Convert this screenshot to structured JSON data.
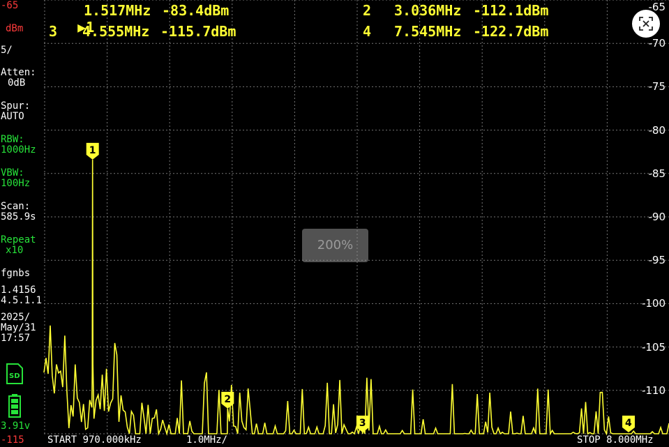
{
  "top_left_ref": "-65",
  "unit": "dBm",
  "scale": "5/",
  "attenuation": {
    "label": "Atten:",
    "value": "0dB"
  },
  "spur": {
    "label": "Spur:",
    "value": "AUTO"
  },
  "rbw": {
    "label": "RBW:",
    "value": "1000Hz"
  },
  "vbw": {
    "label": "VBW:",
    "value": "100Hz"
  },
  "scan": {
    "label": "Scan:",
    "value": "585.9s"
  },
  "repeat": {
    "label": "Repeat",
    "value": "x10"
  },
  "device": {
    "name": "fgnbs",
    "id": "1.4156",
    "version": "4.5.1.1"
  },
  "date": {
    "year": "2025/",
    "day": "May/31",
    "time": "17:57"
  },
  "battery_voltage": "3.91v",
  "bottom_ref": "-115",
  "markers": [
    {
      "num": "1",
      "freq": "1.517MHz",
      "level": "-83.4dBm",
      "active_marker": "▶"
    },
    {
      "num": "2",
      "freq": "3.036MHz",
      "level": "-112.1dBm"
    },
    {
      "num": "3",
      "freq": "4.555MHz",
      "level": "-115.7dBm"
    },
    {
      "num": "4",
      "freq": "7.545MHz",
      "level": "-122.7dBm"
    }
  ],
  "y_axis_labels": [
    "-65",
    "-70",
    "-75",
    "-80",
    "-85",
    "-90",
    "-95",
    "-100",
    "-105",
    "-110"
  ],
  "footer": {
    "start": "START 970.000kHz",
    "per_div": "1.0MHz/",
    "stop": "STOP 8.000MHz"
  },
  "zoom_label": "200%",
  "icons": {
    "sd": "sd-card-icon",
    "battery": "battery-icon",
    "close": "close-icon"
  },
  "colors": {
    "trace": "#ffff33",
    "grid": "#777777",
    "rbw": "#27e33a",
    "ref": "#ff3b3b"
  },
  "chart_data": {
    "type": "line",
    "x_start_mhz": 0.97,
    "x_stop_mhz": 8.0,
    "ylim": [
      -115,
      -65
    ],
    "y_unit": "dBm",
    "peaks": [
      {
        "x": 1.517,
        "y": -83.4
      },
      {
        "x": 3.036,
        "y": -112.1
      },
      {
        "x": 4.555,
        "y": -115.7
      },
      {
        "x": 7.545,
        "y": -122.7
      }
    ]
  }
}
